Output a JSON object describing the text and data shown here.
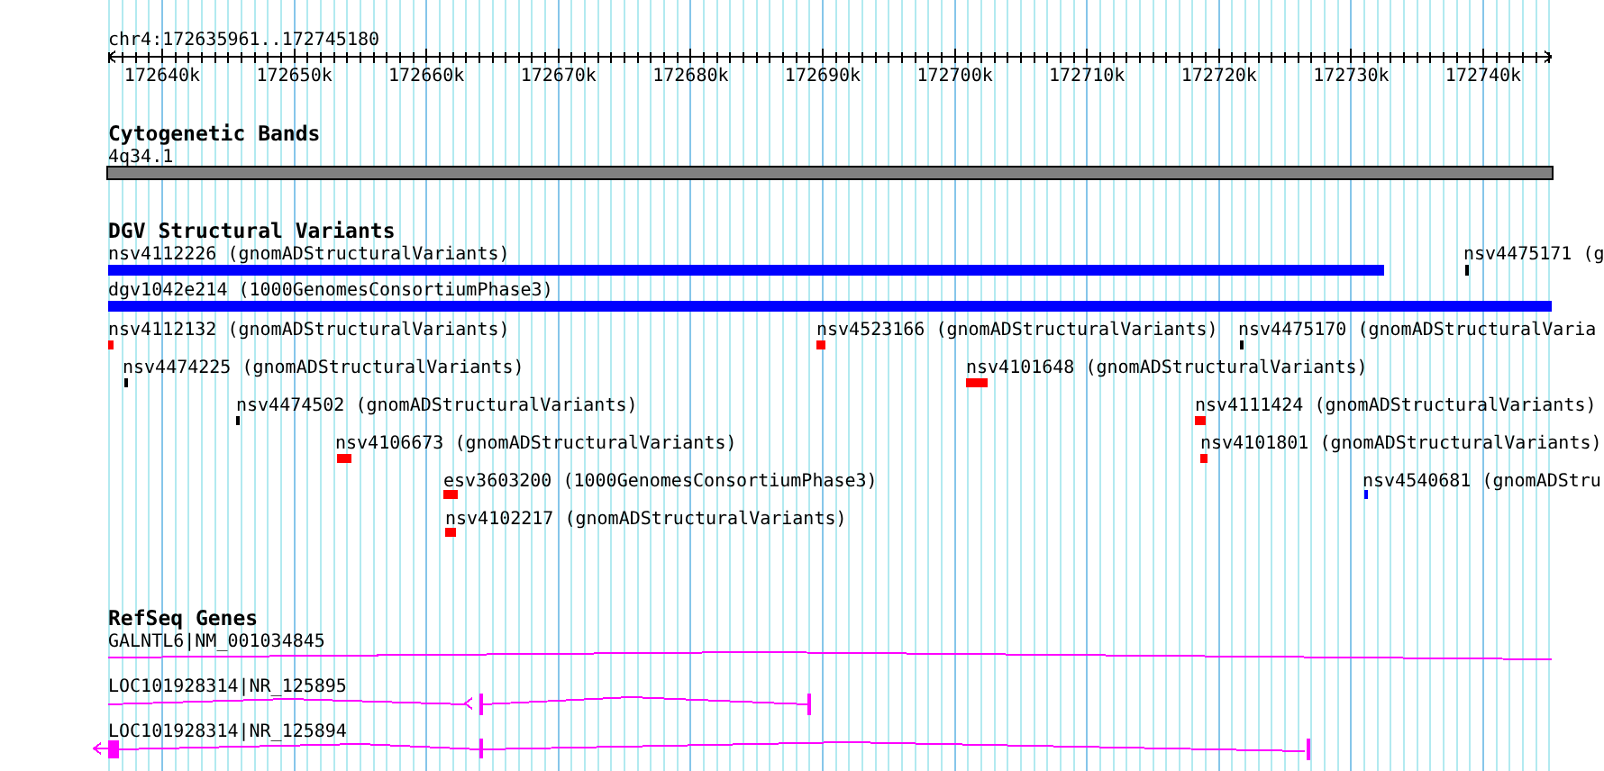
{
  "ruler": {
    "label": "chr4:172635961..172745180",
    "ticks": [
      "172640k",
      "172650k",
      "172660k",
      "172670k",
      "172680k",
      "172690k",
      "172700k",
      "172710k",
      "172720k",
      "172730k",
      "172740k"
    ]
  },
  "tracks": [
    {
      "kind": "bands",
      "title": "Cytogenetic Bands",
      "features": [
        {
          "label": "4q34.1"
        }
      ]
    },
    {
      "kind": "variants",
      "title": "DGV Structural Variants",
      "features": [
        {
          "label": "nsv4112226 (gnomADStructuralVariants)",
          "color": "#0000ff"
        },
        {
          "label": "nsv4475171 (g",
          "color": "#000000"
        },
        {
          "label": "dgv1042e214 (1000GenomesConsortiumPhase3)",
          "color": "#0000ff"
        },
        {
          "label": "nsv4112132 (gnomADStructuralVariants)",
          "color": "#ff0000"
        },
        {
          "label": "nsv4523166 (gnomADStructuralVariants)",
          "color": "#ff0000"
        },
        {
          "label": "nsv4475170 (gnomADStructuralVaria",
          "color": "#000000"
        },
        {
          "label": "nsv4474225 (gnomADStructuralVariants)",
          "color": "#000000"
        },
        {
          "label": "nsv4101648 (gnomADStructuralVariants)",
          "color": "#ff0000"
        },
        {
          "label": "nsv4474502 (gnomADStructuralVariants)",
          "color": "#000000"
        },
        {
          "label": "nsv4111424 (gnomADStructuralVariants)",
          "color": "#ff0000"
        },
        {
          "label": "nsv4106673 (gnomADStructuralVariants)",
          "color": "#ff0000"
        },
        {
          "label": "nsv4101801 (gnomADStructuralVariants)",
          "color": "#ff0000"
        },
        {
          "label": "esv3603200 (1000GenomesConsortiumPhase3)",
          "color": "#ff0000"
        },
        {
          "label": "nsv4540681 (gnomADStru",
          "color": "#0000ff"
        },
        {
          "label": "nsv4102217 (gnomADStructuralVariants)",
          "color": "#ff0000"
        }
      ]
    },
    {
      "kind": "genes",
      "title": "RefSeq Genes",
      "features": [
        {
          "label": "GALNTL6|NM_001034845"
        },
        {
          "label": "LOC101928314|NR_125895"
        },
        {
          "label": "LOC101928314|NR_125894"
        }
      ]
    }
  ]
}
